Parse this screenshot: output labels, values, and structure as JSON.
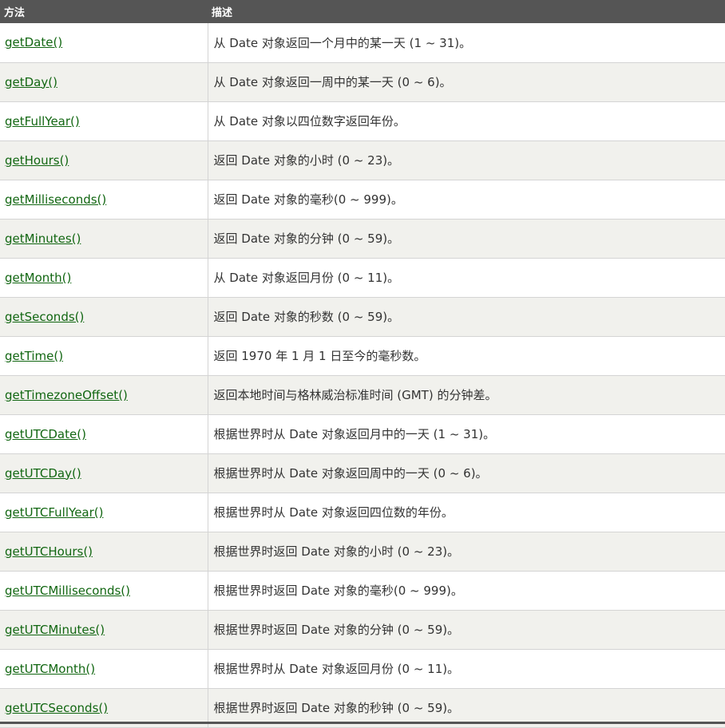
{
  "table": {
    "headers": {
      "method": "方法",
      "description": "描述"
    },
    "rows": [
      {
        "method": "getDate()",
        "description": "从 Date 对象返回一个月中的某一天 (1 ~ 31)。"
      },
      {
        "method": "getDay()",
        "description": "从 Date 对象返回一周中的某一天 (0 ~ 6)。"
      },
      {
        "method": "getFullYear()",
        "description": "从 Date 对象以四位数字返回年份。"
      },
      {
        "method": "getHours()",
        "description": "返回 Date 对象的小时 (0 ~ 23)。"
      },
      {
        "method": "getMilliseconds()",
        "description": "返回 Date 对象的毫秒(0 ~ 999)。"
      },
      {
        "method": "getMinutes()",
        "description": "返回 Date 对象的分钟 (0 ~ 59)。"
      },
      {
        "method": "getMonth()",
        "description": "从 Date 对象返回月份 (0 ~ 11)。"
      },
      {
        "method": "getSeconds()",
        "description": "返回 Date 对象的秒数 (0 ~ 59)。"
      },
      {
        "method": "getTime()",
        "description": "返回 1970 年 1 月 1 日至今的毫秒数。"
      },
      {
        "method": "getTimezoneOffset()",
        "description": "返回本地时间与格林威治标准时间 (GMT) 的分钟差。"
      },
      {
        "method": "getUTCDate()",
        "description": "根据世界时从 Date 对象返回月中的一天 (1 ~ 31)。"
      },
      {
        "method": "getUTCDay()",
        "description": "根据世界时从 Date 对象返回周中的一天 (0 ~ 6)。"
      },
      {
        "method": "getUTCFullYear()",
        "description": "根据世界时从 Date 对象返回四位数的年份。"
      },
      {
        "method": "getUTCHours()",
        "description": "根据世界时返回 Date 对象的小时 (0 ~ 23)。"
      },
      {
        "method": "getUTCMilliseconds()",
        "description": "根据世界时返回 Date 对象的毫秒(0 ~ 999)。"
      },
      {
        "method": "getUTCMinutes()",
        "description": "根据世界时返回 Date 对象的分钟 (0 ~ 59)。"
      },
      {
        "method": "getUTCMonth()",
        "description": "根据世界时从 Date 对象返回月份 (0 ~ 11)。"
      },
      {
        "method": "getUTCSeconds()",
        "description": "根据世界时返回 Date 对象的秒钟 (0 ~ 59)。"
      }
    ]
  },
  "colors": {
    "header_bg": "#555555",
    "header_text": "#ffffff",
    "link": "#116611",
    "row_alt_bg": "#f1f1ed"
  }
}
